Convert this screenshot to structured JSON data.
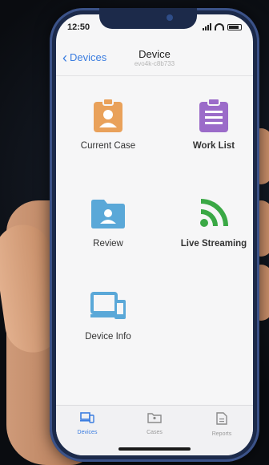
{
  "status": {
    "time": "12:50"
  },
  "nav": {
    "back_label": "Devices",
    "title": "Device",
    "subtitle": "evo4k-c8b733"
  },
  "tiles": [
    {
      "label": "Current Case",
      "icon": "badge-icon",
      "color": "#e9a15a"
    },
    {
      "label": "Work List",
      "icon": "clipboard-icon",
      "color": "#9b6bc9"
    },
    {
      "label": "Review",
      "icon": "folder-user-icon",
      "color": "#5aa8d8"
    },
    {
      "label": "Live Streaming",
      "icon": "broadcast-icon",
      "color": "#3aa845"
    },
    {
      "label": "Device Info",
      "icon": "devices-icon",
      "color": "#5aa8d8"
    }
  ],
  "tabbar": [
    {
      "label": "Devices",
      "active": true
    },
    {
      "label": "Cases",
      "active": false
    },
    {
      "label": "Reports",
      "active": false
    }
  ],
  "colors": {
    "accent": "#3b7de0"
  }
}
